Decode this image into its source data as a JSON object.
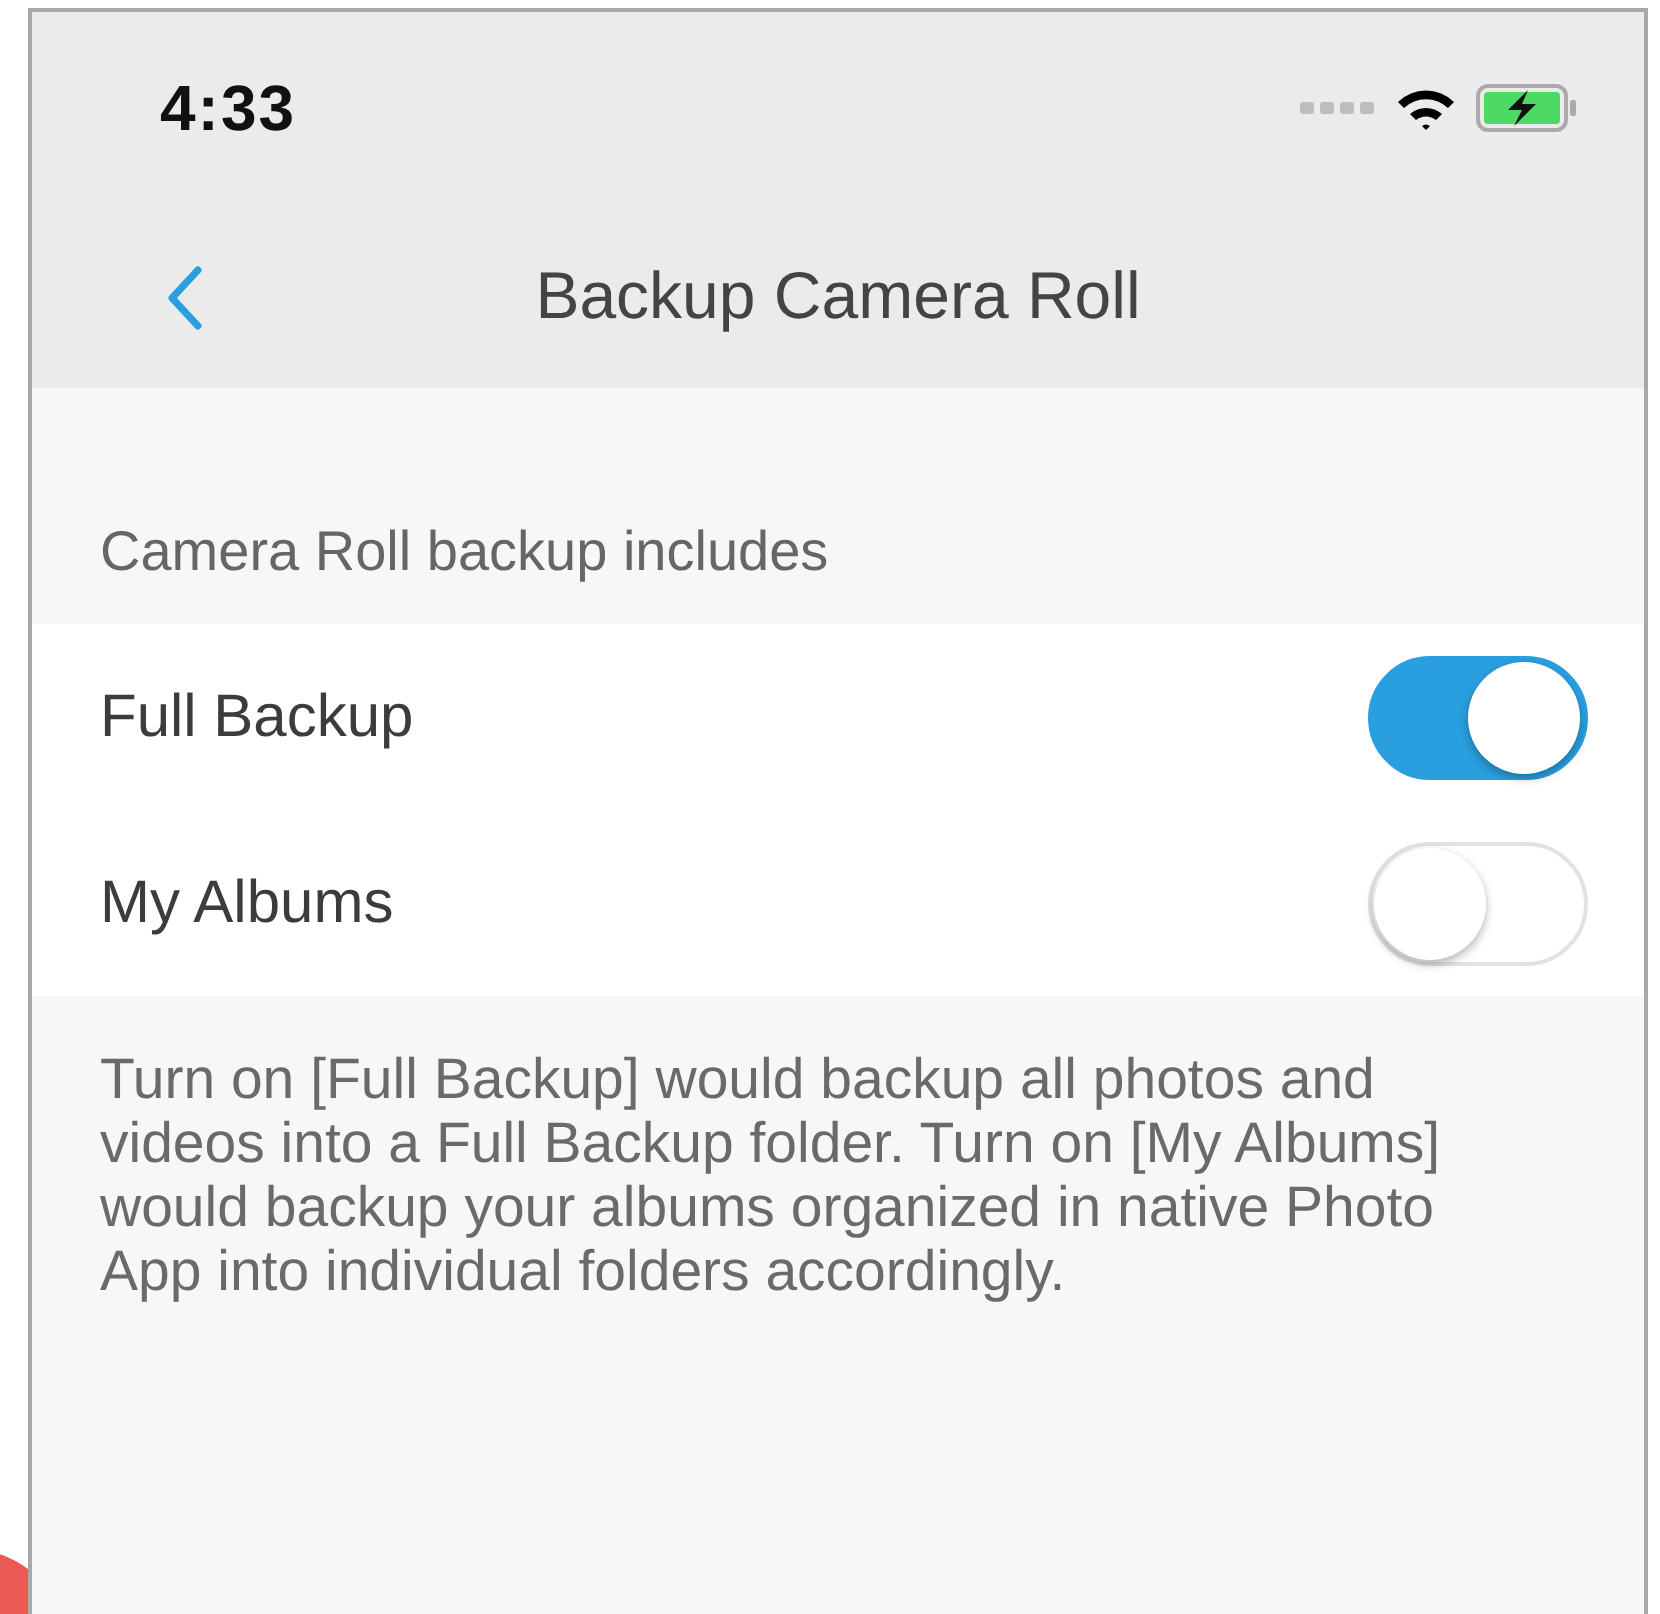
{
  "status_bar": {
    "time": "4:33"
  },
  "nav_bar": {
    "title": "Backup Camera Roll"
  },
  "section": {
    "header": "Camera Roll backup includes",
    "rows": [
      {
        "label": "Full Backup",
        "on": true
      },
      {
        "label": "My Albums",
        "on": false
      }
    ],
    "footer": "Turn on [Full Backup] would backup all photos and videos into a Full Backup folder. Turn on [My Albums] would backup your albums organized in native Photo App into individual folders accordingly."
  }
}
